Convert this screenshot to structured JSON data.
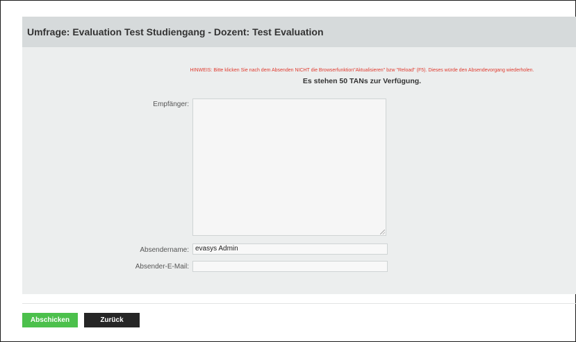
{
  "panel": {
    "title": "Umfrage: Evaluation Test Studiengang - Dozent: Test Evaluation"
  },
  "notice": {
    "text": "HINWEIS: Bitte klicken Sie nach dem Absenden NICHT die Browserfunktion\"Aktualisieren\" bzw \"Reload\" (F5). Dieses würde den Absendevorgang wiederholen."
  },
  "tans": {
    "text": "Es stehen 50 TANs zur Verfügung."
  },
  "form": {
    "recipient_label": "Empfänger:",
    "recipient_value": "",
    "sender_name_label": "Absendername:",
    "sender_name_value": "evasys Admin",
    "sender_email_label": "Absender-E-Mail:",
    "sender_email_value": ""
  },
  "actions": {
    "submit_label": "Abschicken",
    "back_label": "Zurück"
  },
  "colors": {
    "notice": "#e03a2e",
    "submit": "#4cc04c",
    "back": "#262626",
    "panel": "#eceeee",
    "header": "#d6dadb"
  }
}
